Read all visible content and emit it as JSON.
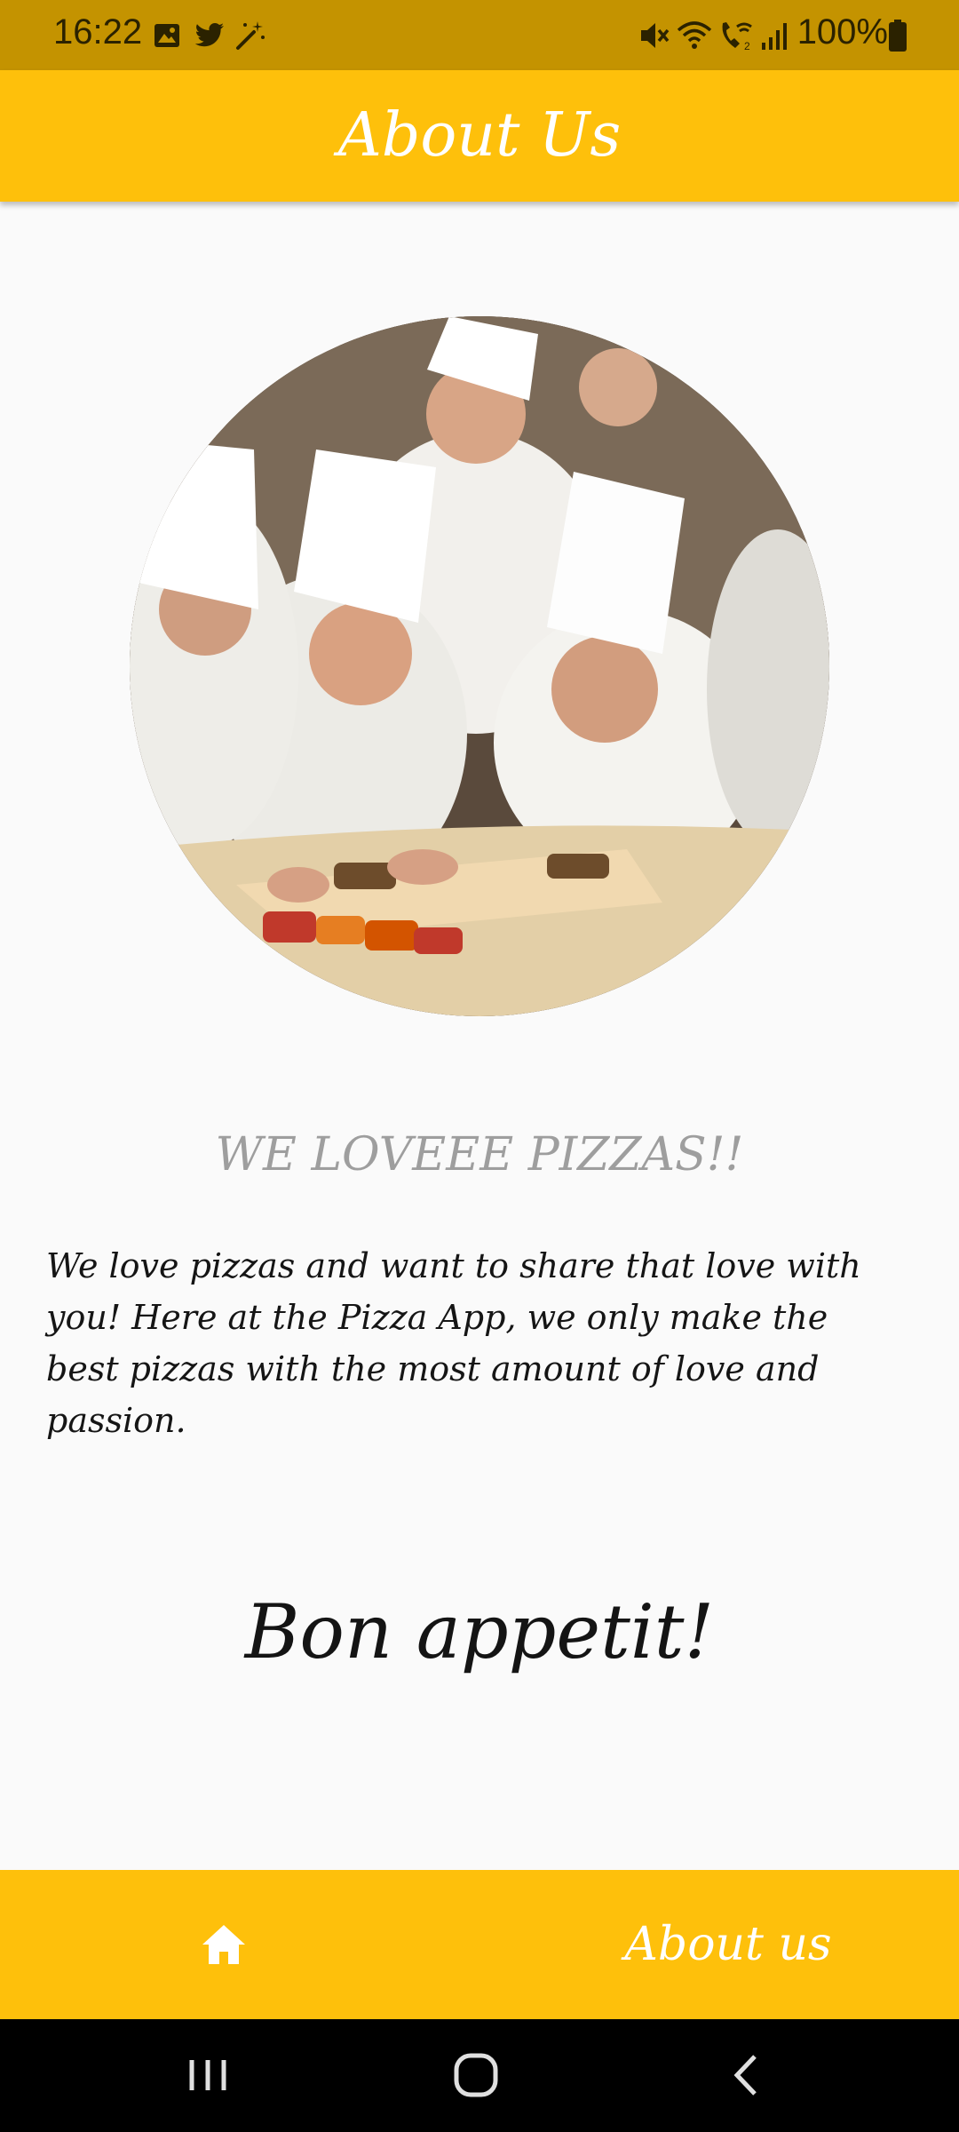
{
  "status_bar": {
    "time": "16:22",
    "battery": "100%",
    "left_icons": [
      "image-icon",
      "twitter-icon",
      "magic-wand-icon"
    ],
    "right_icons": [
      "mute-icon",
      "wifi-icon",
      "wifi-calling-icon",
      "signal-icon",
      "battery-icon"
    ]
  },
  "app_bar": {
    "title": "About Us"
  },
  "main": {
    "headline": "WE LOVEEE PIZZAS!!",
    "description": "We love pizzas and want to share that love with you! Here at the Pizza App, we only make the best pizzas with the most amount of love and passion.",
    "signoff": "Bon appetit!"
  },
  "bottom_nav": {
    "home_icon": "home-icon",
    "about_label": "About us"
  },
  "system_nav": {
    "buttons": [
      "recent-apps-icon",
      "home-circle-icon",
      "back-icon"
    ]
  },
  "colors": {
    "accent": "#fec00b",
    "status_bar": "#c49300",
    "background": "#fafafa",
    "headline": "#9e9e9e"
  }
}
